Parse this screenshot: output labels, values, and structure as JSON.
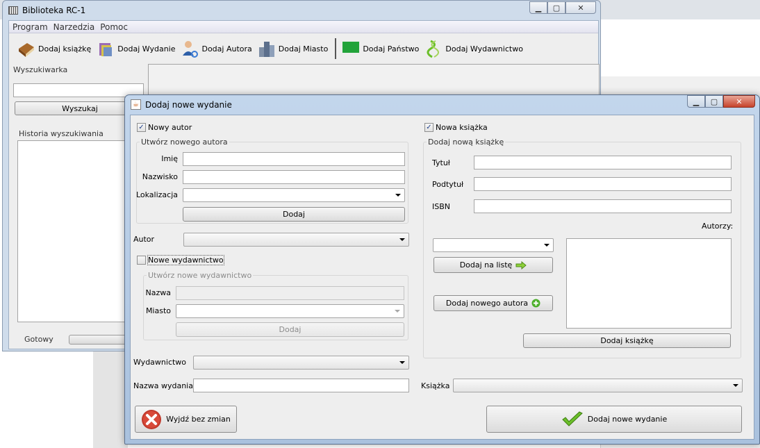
{
  "main_window": {
    "title": "Biblioteka RC-1",
    "menu": [
      "Program",
      "Narzedzia",
      "Pomoc"
    ],
    "toolbar": [
      {
        "label": "Dodaj książkę",
        "icon": "book-icon"
      },
      {
        "label": "Dodaj Wydanie",
        "icon": "edition-icon"
      },
      {
        "label": "Dodaj Autora",
        "icon": "author-icon"
      },
      {
        "label": "Dodaj Miasto",
        "icon": "city-icon"
      },
      {
        "label": "Dodaj Państwo",
        "icon": "flag-icon"
      },
      {
        "label": "Dodaj Wydawnictwo",
        "icon": "publisher-icon"
      }
    ],
    "search": {
      "group_title": "Wyszukiwarka",
      "button": "Wyszukaj",
      "value": ""
    },
    "history": {
      "group_title": "Historia wyszukiwania"
    },
    "status": "Gotowy"
  },
  "dialog": {
    "title": "Dodaj nowe wydanie",
    "author": {
      "new_checkbox_label": "Nowy autor",
      "new_checked": true,
      "group_title": "Utwórz nowego autora",
      "first_name_label": "Imię",
      "last_name_label": "Nazwisko",
      "location_label": "Lokalizacja",
      "add_button": "Dodaj",
      "select_label": "Autor"
    },
    "publisher": {
      "new_checkbox_label": "Nowe wydawnictwo",
      "new_checked": false,
      "group_title": "Utwórz nowe wydawnictwo",
      "name_label": "Nazwa",
      "city_label": "Miasto",
      "add_button": "Dodaj",
      "select_label": "Wydawnictwo"
    },
    "edition_name_label": "Nazwa wydania",
    "book": {
      "new_checkbox_label": "Nowa książka",
      "new_checked": true,
      "group_title": "Dodaj nową książkę",
      "title_label": "Tytuł",
      "subtitle_label": "Podtytuł",
      "isbn_label": "ISBN",
      "authors_label": "Autorzy:",
      "add_to_list_button": "Dodaj na listę",
      "add_new_author_button": "Dodaj nowego autora",
      "add_book_button": "Dodaj książkę",
      "select_label": "Książka"
    },
    "exit_button": "Wyjdź bez zmian",
    "submit_button": "Dodaj nowe wydanie"
  },
  "colors": {
    "accent_green": "#6cbf2a",
    "close_red": "#c0392b",
    "title_bar": "#c3d6ec"
  }
}
